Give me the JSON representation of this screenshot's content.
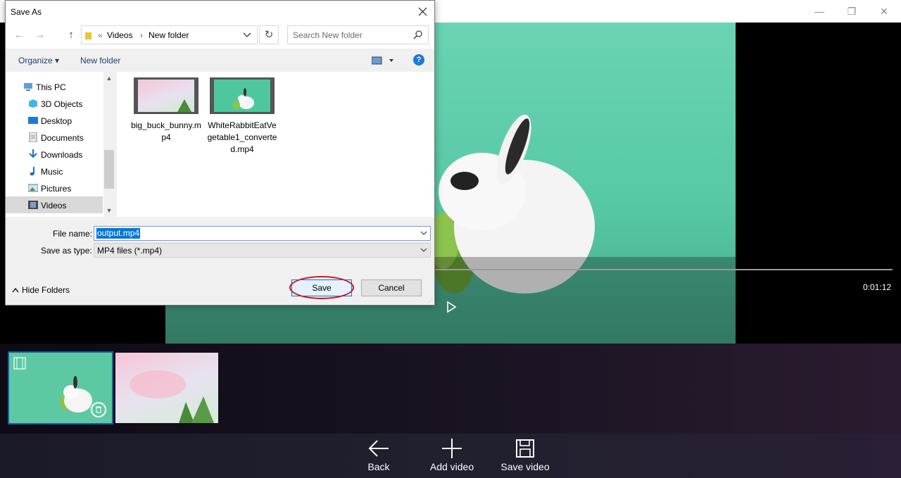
{
  "app": {
    "window_controls": {
      "minimize": "—",
      "restore": "❐",
      "close": "✕"
    },
    "player": {
      "time": "0:01:12"
    },
    "bottom_bar": {
      "back_label": "Back",
      "add_label": "Add video",
      "save_label": "Save video"
    }
  },
  "dialog": {
    "title": "Save As",
    "breadcrumb": {
      "root_sep": "«",
      "parent": "Videos",
      "sep": "›",
      "current": "New folder"
    },
    "search_placeholder": "Search New folder",
    "toolbar": {
      "organize": "Organize ▾",
      "new_folder": "New folder"
    },
    "help": "?",
    "nav_items": [
      {
        "label": "This PC",
        "icon": "pc-icon"
      },
      {
        "label": "3D Objects",
        "icon": "cube-icon"
      },
      {
        "label": "Desktop",
        "icon": "desktop-icon"
      },
      {
        "label": "Documents",
        "icon": "document-icon"
      },
      {
        "label": "Downloads",
        "icon": "download-icon"
      },
      {
        "label": "Music",
        "icon": "music-icon"
      },
      {
        "label": "Pictures",
        "icon": "pictures-icon"
      },
      {
        "label": "Videos",
        "icon": "video-icon",
        "selected": true
      }
    ],
    "files": [
      {
        "name": "big_buck_bunny.mp4"
      },
      {
        "name": "WhiteRabbitEatVegetable1_converted.mp4"
      }
    ],
    "file_name_label": "File name:",
    "file_name_value": "output.mp4",
    "save_type_label": "Save as type:",
    "save_type_value": "MP4 files (*.mp4)",
    "hide_folders": "Hide Folders",
    "save_button": "Save",
    "cancel_button": "Cancel"
  },
  "colors": {
    "accent": "#0078d7",
    "highlight_ring": "#d4131f",
    "video_bg": "#58c9a7"
  }
}
